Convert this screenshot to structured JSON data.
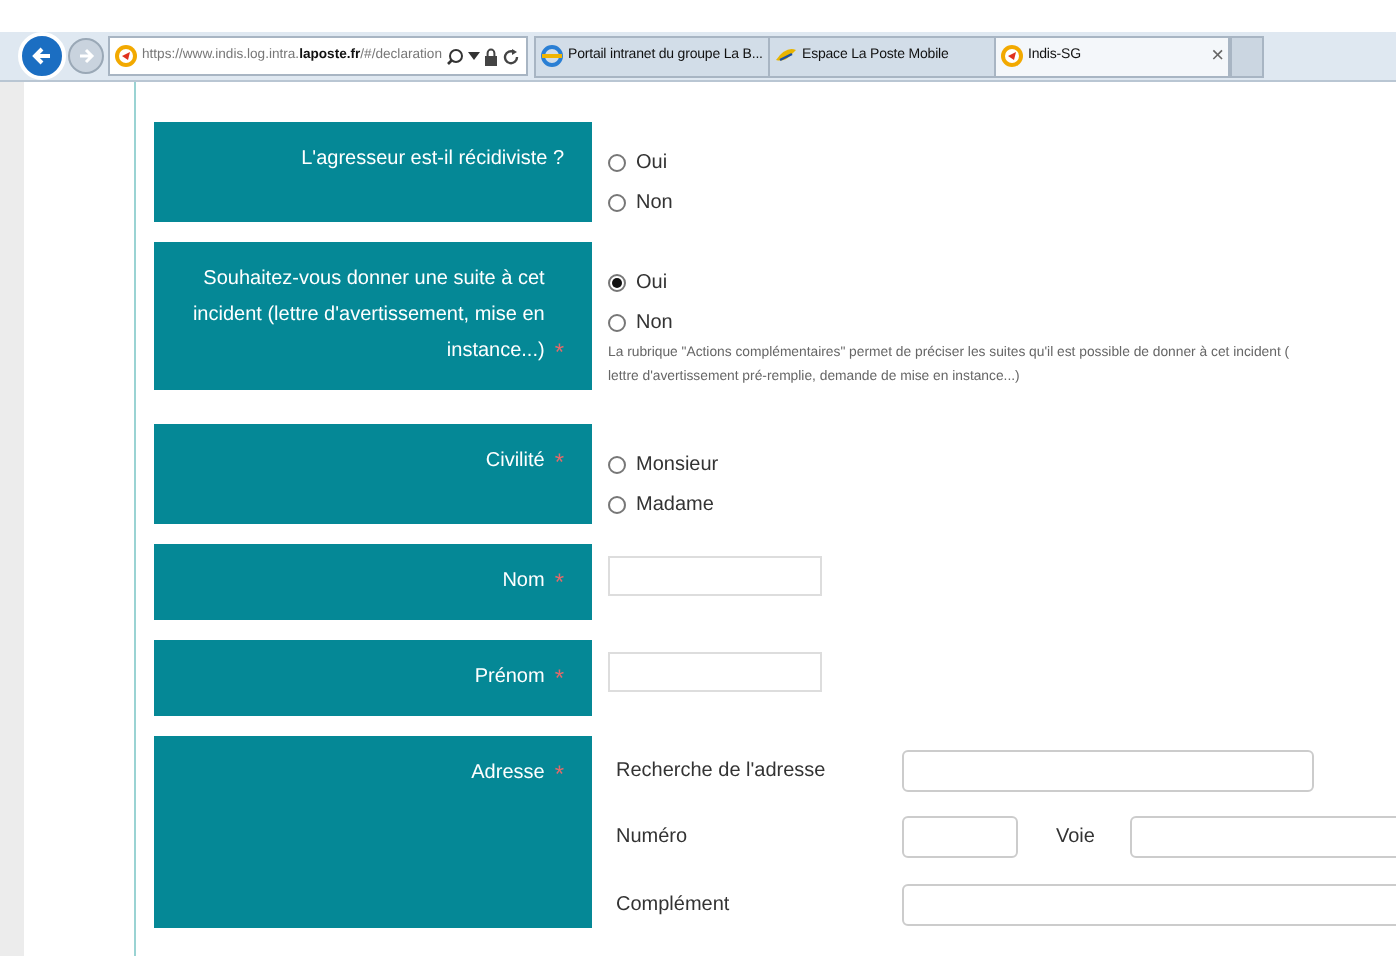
{
  "browser": {
    "url": "https://www.indis.log.intra.**laposte.fr**/#/declaration",
    "tabs": [
      {
        "label": "Portail intranet du groupe La B...",
        "selected": false
      },
      {
        "label": "Espace La Poste Mobile",
        "selected": false
      },
      {
        "label": "Indis-SG",
        "selected": true,
        "close": "×"
      }
    ]
  },
  "form": {
    "sections": [
      [
        {
          "kind": "radio",
          "label": "L'agresseur est-il récidiviste ?",
          "options": [
            {
              "label": "Oui",
              "selected": false
            },
            {
              "label": "Non",
              "selected": false
            }
          ]
        },
        {
          "kind": "radio",
          "label": "Souhaitez-vous donner une suite à cet incident (lettre d'avertissement, mise en instance...)",
          "marker": "*",
          "options": [
            {
              "label": "Oui",
              "selected": true
            },
            {
              "label": "Non",
              "selected": false
            }
          ],
          "help": [
            "La rubrique \"Actions complémentaires\" permet de préciser les suites qu'il est possible de donner à cet incident (",
            "lettre d'avertissement pré-remplie, demande de mise en instance...)"
          ]
        }
      ],
      [
        {
          "kind": "radio",
          "label": "Civilité",
          "marker": "*",
          "options": [
            {
              "label": "Monsieur",
              "selected": false
            },
            {
              "label": "Madame",
              "selected": false
            }
          ]
        },
        {
          "kind": "text",
          "label": "Nom",
          "marker": "*"
        },
        {
          "kind": "text",
          "label": "Prénom",
          "marker": "*"
        },
        {
          "kind": "address",
          "label": "Adresse",
          "marker": "*",
          "lines": [
            {
              "kind": "search",
              "label": "Recherche de l'adresse"
            },
            {
              "kind": "split",
              "label": "Numéro",
              "second_label": "Voie"
            },
            {
              "kind": "full",
              "label": "Complément"
            }
          ]
        }
      ]
    ]
  }
}
